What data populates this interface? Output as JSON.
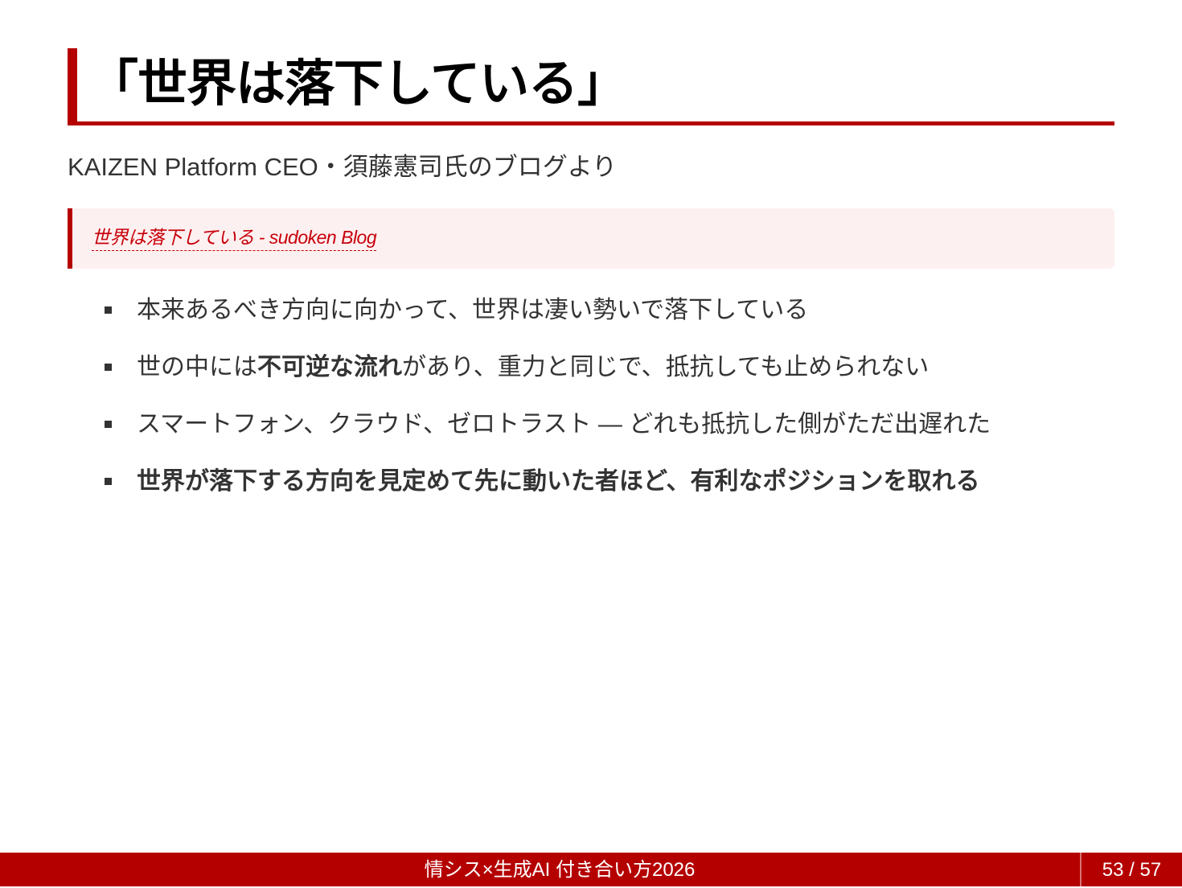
{
  "slide": {
    "title": "「世界は落下している」",
    "subtitle": "KAIZEN Platform CEO・須藤憲司氏のブログより",
    "quote": {
      "link_text": "世界は落下している - sudoken Blog"
    },
    "bullets": [
      {
        "before": "本来あるべき方向に向かって、世界は凄い勢いで落下している",
        "bold": "",
        "after": ""
      },
      {
        "before": "世の中には",
        "bold": "不可逆な流れ",
        "after": "があり、重力と同じで、抵抗しても止められない"
      },
      {
        "before": "スマートフォン、クラウド、ゼロトラスト — どれも抵抗した側がただ出遅れた",
        "bold": "",
        "after": ""
      },
      {
        "before": "",
        "bold": "世界が落下する方向を見定めて先に動いた者ほど、有利なポジションを取れる",
        "after": ""
      }
    ]
  },
  "footer": {
    "title": "情シス×生成AI 付き合い方2026",
    "page_indicator": "53 / 57"
  },
  "colors": {
    "accent": "#b50000",
    "quote_background": "#fdf0f0",
    "link": "#c8000a",
    "text": "#333333"
  }
}
